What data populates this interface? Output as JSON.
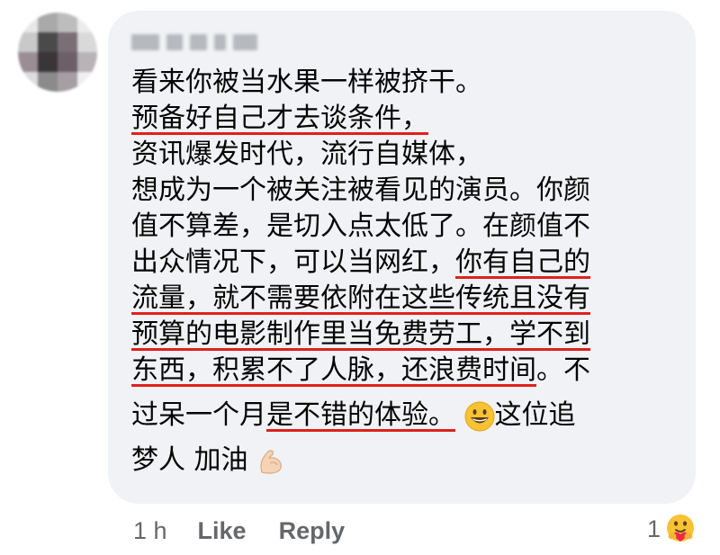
{
  "comment": {
    "author": "",
    "lines": [
      {
        "segments": [
          {
            "text": "看来你被当水果一样被挤干。",
            "underline": false
          }
        ]
      },
      {
        "segments": [
          {
            "text": "预备好自己才去谈条件，",
            "underline": true
          }
        ]
      },
      {
        "segments": [
          {
            "text": "资讯爆发时代，流行自媒体，",
            "underline": false
          }
        ]
      },
      {
        "segments": [
          {
            "text": "想成为一个被关注被看见的演员。你颜",
            "underline": false
          }
        ]
      },
      {
        "segments": [
          {
            "text": "值不算差，是切入点太低了。在颜值不",
            "underline": false
          }
        ]
      },
      {
        "segments": [
          {
            "text": "出众情况下，可以当网红，",
            "underline": false
          },
          {
            "text": "你有自己的",
            "underline": true
          }
        ]
      },
      {
        "segments": [
          {
            "text": "流量，就不需要依附在这些传统且没有",
            "underline": true
          }
        ]
      },
      {
        "segments": [
          {
            "text": "预算的电影制作里当免费劳工，学不到",
            "underline": true
          }
        ]
      },
      {
        "segments": [
          {
            "text": "东西，积累不了人脉，还浪费时间",
            "underline": true
          },
          {
            "text": "。不",
            "underline": false
          }
        ]
      },
      {
        "segments": [
          {
            "text": "过呆一个月",
            "underline": false
          },
          {
            "text": "是不错的体验。",
            "underline": true
          }
        ],
        "emoji_after": "grinning-face-emoji",
        "tail": "这位追"
      },
      {
        "segments": [
          {
            "text": "梦人 加油",
            "underline": false
          }
        ],
        "emoji_after": "flexed-biceps-emoji"
      }
    ],
    "underline_color": "#e0201c",
    "bubble_color": "#f0f2f5"
  },
  "actions": {
    "time": "1 h",
    "like_label": "Like",
    "reply_label": "Reply"
  },
  "reactions": {
    "count": "1",
    "icon": "care-reaction-icon"
  }
}
